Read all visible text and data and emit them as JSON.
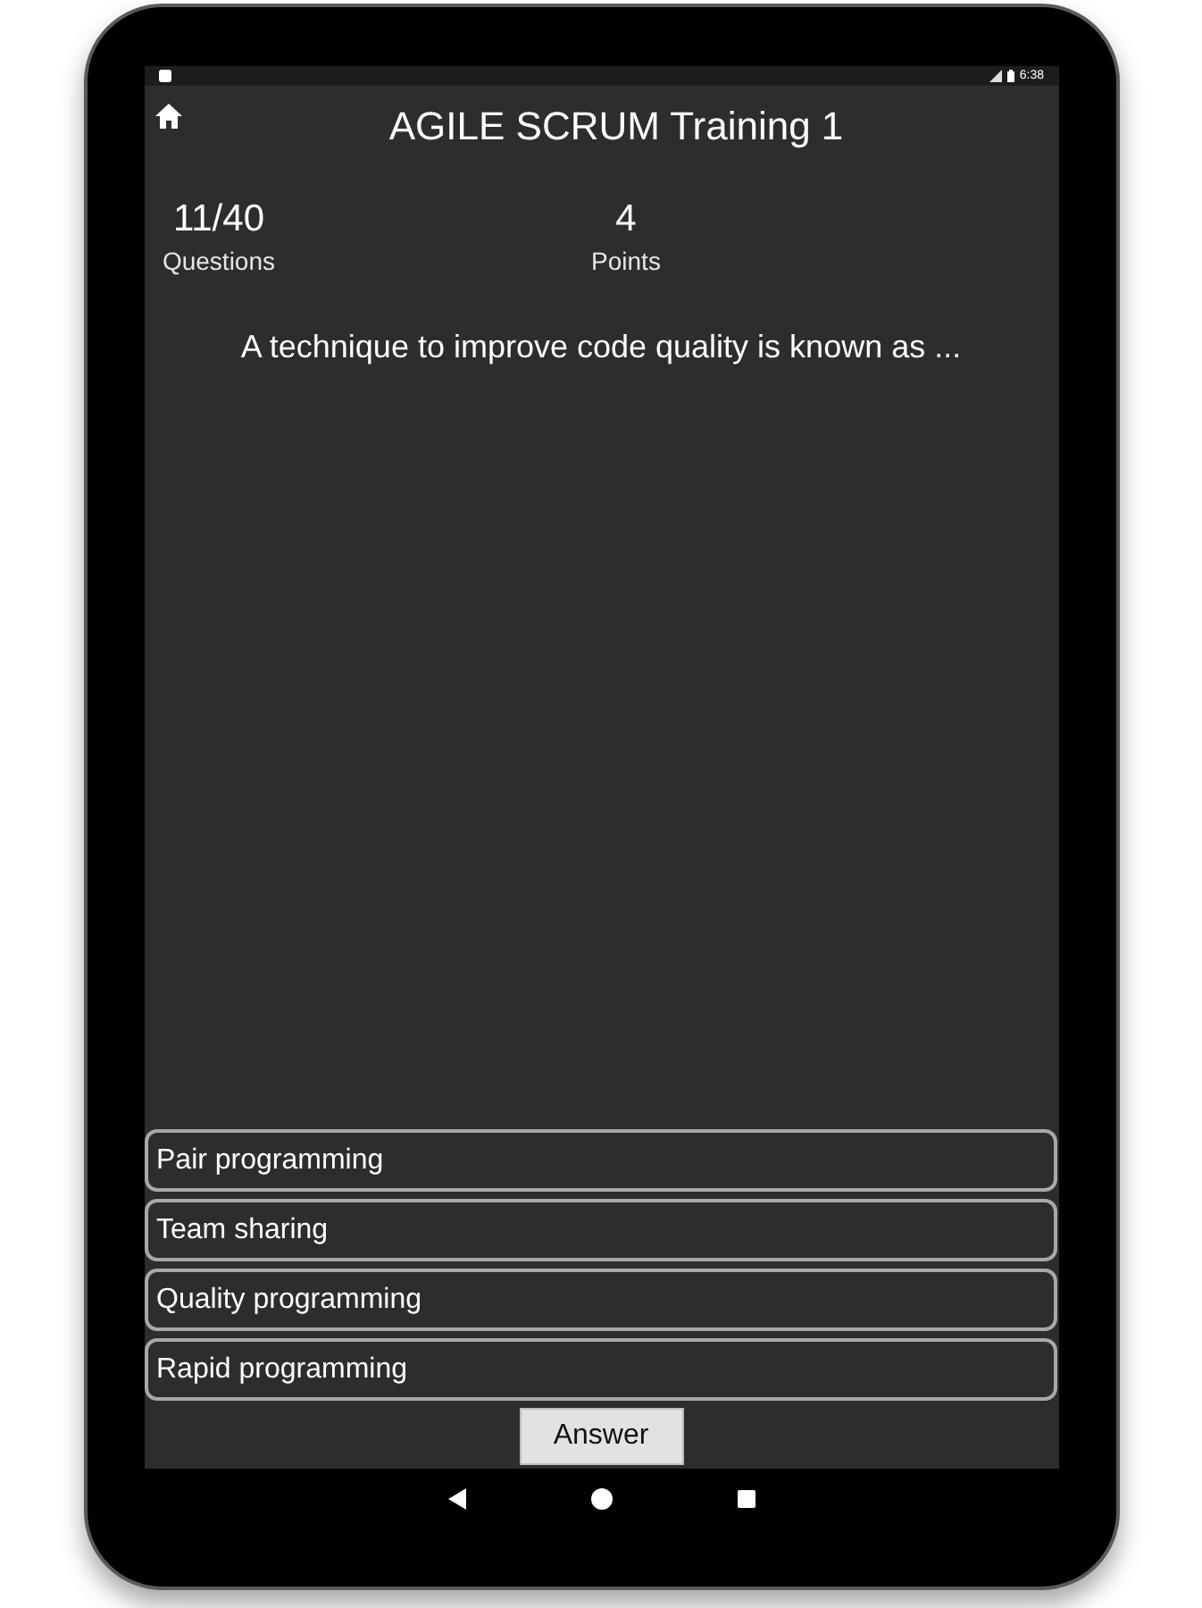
{
  "status_bar": {
    "time": "6:38"
  },
  "title": "AGILE SCRUM Training 1",
  "stats": [
    {
      "value": "11/40",
      "label": "Questions"
    },
    {
      "value": "4",
      "label": "Points"
    }
  ],
  "question": "A technique to improve code quality is known as ...",
  "options": [
    {
      "label": "Pair programming",
      "selected": false
    },
    {
      "label": "Team sharing",
      "selected": false
    },
    {
      "label": "Quality programming",
      "selected": false
    },
    {
      "label": "Rapid programming",
      "selected": false
    }
  ],
  "answer_button": "Answer"
}
